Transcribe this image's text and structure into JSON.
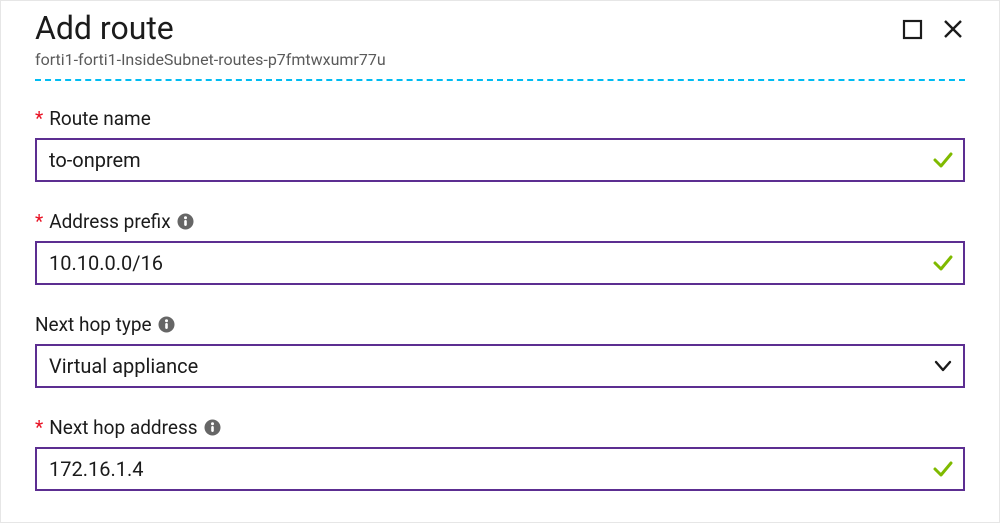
{
  "header": {
    "title": "Add route",
    "subtitle": "forti1-forti1-InsideSubnet-routes-p7fmtwxumr77u"
  },
  "fields": {
    "routeName": {
      "label": "Route name",
      "value": "to-onprem",
      "required": true
    },
    "addressPrefix": {
      "label": "Address prefix",
      "value": "10.10.0.0/16",
      "required": true
    },
    "nextHopType": {
      "label": "Next hop type",
      "value": "Virtual appliance",
      "required": false
    },
    "nextHopAddress": {
      "label": "Next hop address",
      "value": "172.16.1.4",
      "required": true
    }
  },
  "colors": {
    "accent": "#5c2e91",
    "requiredStar": "#e81123",
    "valid": "#7fba00",
    "divider": "#00bcf2"
  }
}
